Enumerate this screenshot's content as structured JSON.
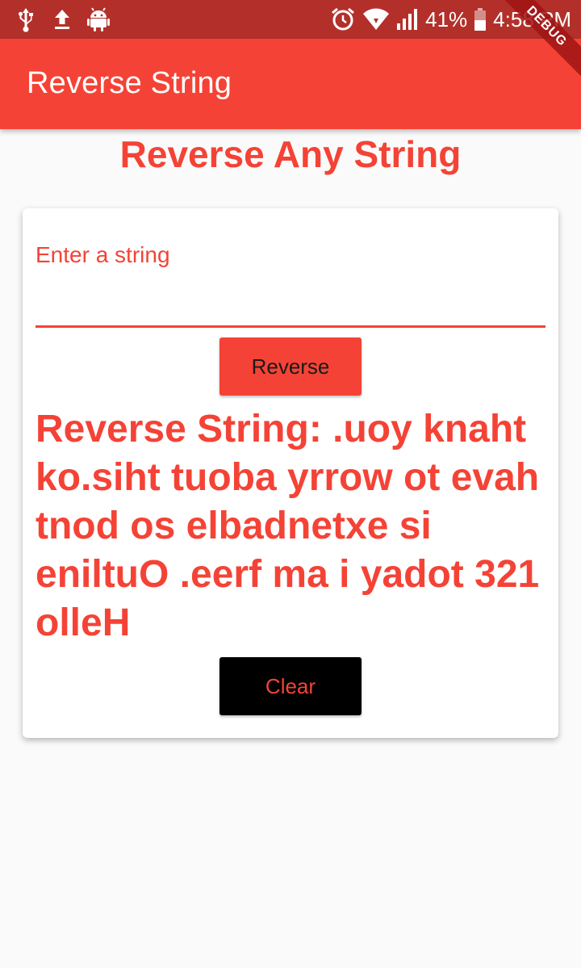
{
  "status_bar": {
    "battery_percent": "41%",
    "time": "4:58 PM",
    "icons": [
      "usb-icon",
      "upload-icon",
      "android-icon",
      "alarm-icon",
      "wifi-icon",
      "signal-icon",
      "battery-icon"
    ]
  },
  "app_bar": {
    "title": "Reverse String",
    "debug_banner": "DEBUG"
  },
  "main": {
    "heading": "Reverse Any String",
    "input": {
      "label": "Enter a string",
      "value": ""
    },
    "reverse_button_label": "Reverse",
    "result_text": "Reverse String: .uoy knaht ko.siht tuoba yrrow ot evah tnod os elbadnetxe si eniltuO .eerf ma i yadot 321 olleH",
    "clear_button_label": "Clear"
  },
  "colors": {
    "primary": "#f44336",
    "status_bar": "#b3302a",
    "background": "#fafafa",
    "card": "#ffffff",
    "clear_button": "#000000"
  }
}
